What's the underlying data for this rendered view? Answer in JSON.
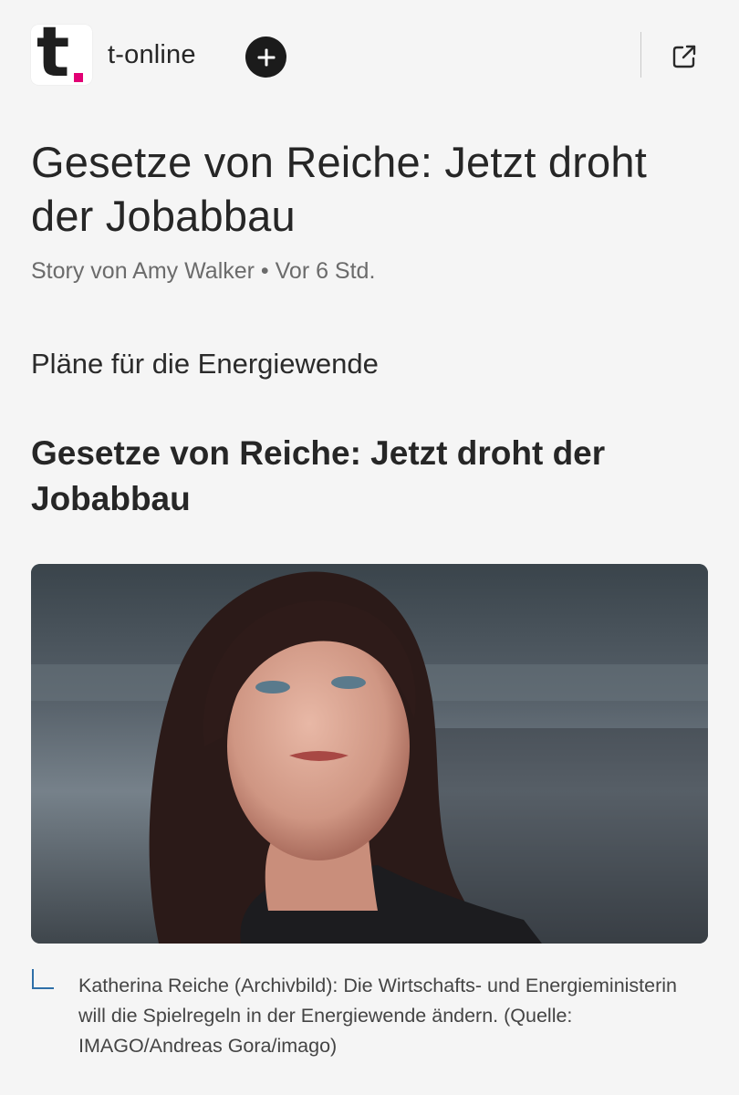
{
  "header": {
    "logo_letter": "t",
    "brand_accent": "#e20074",
    "publisher": "t-online",
    "follow_icon": "plus-icon",
    "open_icon": "external-link-icon"
  },
  "article": {
    "title": "Gesetze von Reiche: Jetzt droht der Jobabbau",
    "byline": "Story von Amy Walker • Vor 6 Std.",
    "kicker": "Pläne für die Energiewende",
    "headline": "Gesetze von Reiche: Jetzt droht der Jobabbau",
    "image_caption": "Katherina Reiche (Archivbild): Die Wirtschafts- und Energieministerin will die Spielregeln in der Energiewende ändern. (Quelle: IMAGO/Andreas Gora/imago)"
  }
}
